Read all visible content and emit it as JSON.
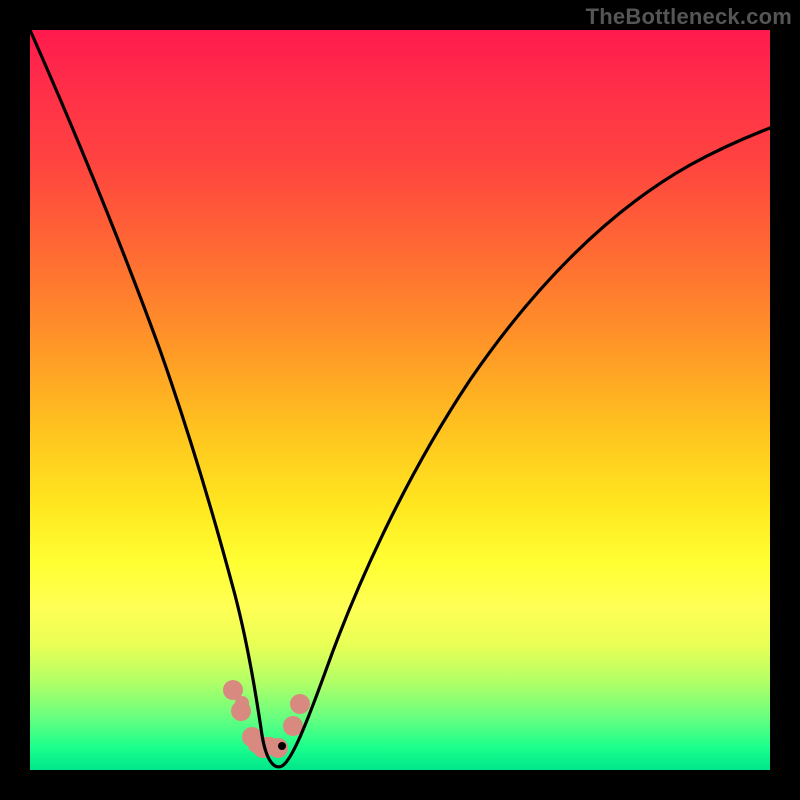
{
  "watermark": "TheBottleneck.com",
  "chart_data": {
    "type": "line",
    "title": "",
    "xlabel": "",
    "ylabel": "",
    "xlim": [
      0,
      100
    ],
    "ylim": [
      0,
      100
    ],
    "grid": false,
    "legend": false,
    "series": [
      {
        "name": "bottleneck-curve",
        "x": [
          0,
          5,
          10,
          15,
          20,
          24,
          27,
          29,
          30.5,
          32,
          34,
          36,
          40,
          45,
          50,
          55,
          60,
          65,
          70,
          75,
          80,
          85,
          90,
          95,
          100
        ],
        "values": [
          100,
          88,
          74,
          60,
          45,
          30,
          18,
          10,
          4,
          2,
          1,
          2,
          8,
          18,
          28,
          37,
          45,
          52,
          59,
          65,
          70,
          74,
          78,
          81,
          83
        ]
      }
    ],
    "markers_salmon": {
      "name": "salmon-dots",
      "x": [
        27.5,
        28.5,
        30,
        31.5,
        33.5,
        35.5,
        36.5
      ],
      "values": [
        11,
        8,
        4.5,
        3,
        3,
        6,
        9
      ]
    },
    "marker_black": {
      "x": 34,
      "y": 3.3
    },
    "background_gradient_stops": [
      {
        "pos": 0,
        "color": "#ff1a4d"
      },
      {
        "pos": 18,
        "color": "#ff4440"
      },
      {
        "pos": 42,
        "color": "#ff9428"
      },
      {
        "pos": 64,
        "color": "#ffe61f"
      },
      {
        "pos": 78,
        "color": "#ffff55"
      },
      {
        "pos": 93,
        "color": "#66ff80"
      },
      {
        "pos": 100,
        "color": "#00e68a"
      }
    ]
  }
}
